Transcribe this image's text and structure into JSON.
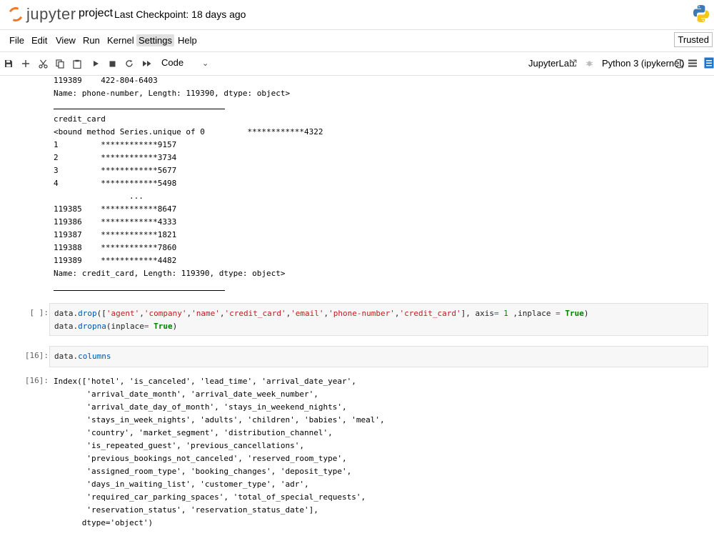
{
  "header": {
    "logo_text": "jupyter",
    "notebook_name": "project",
    "checkpoint": "Last Checkpoint: 18 days ago"
  },
  "menu": {
    "items": [
      "File",
      "Edit",
      "View",
      "Run",
      "Kernel",
      "Settings",
      "Help"
    ],
    "active": "Settings",
    "trusted": "Trusted"
  },
  "toolbar": {
    "cell_type": "Code",
    "jupyterlab_label": "JupyterLab",
    "kernel_name": "Python 3 (ipykernel)"
  },
  "output_top": {
    "lines": [
      "119389    422-804-6403",
      "Name: phone-number, Length: 119390, dtype: object>"
    ]
  },
  "output_credit": {
    "lines": [
      "credit_card",
      "<bound method Series.unique of 0         ************4322",
      "1         ************9157",
      "2         ************3734",
      "3         ************5677",
      "4         ************5498",
      "                ...",
      "119385    ************8647",
      "119386    ************4333",
      "119387    ************1821",
      "119388    ************7860",
      "119389    ************4482",
      "Name: credit_card, Length: 119390, dtype: object>"
    ]
  },
  "cell_drop": {
    "prompt": "[ ]:",
    "line1": {
      "obj": "data",
      "method": "drop",
      "args": [
        "'agent'",
        "'company'",
        "'name'",
        "'credit_card'",
        "'email'",
        "'phone-number'",
        "'credit_card'"
      ],
      "axis_kw": "axis",
      "axis_val": "1",
      "inplace_kw": "inplace",
      "inplace_val": "True"
    },
    "line2": {
      "obj": "data",
      "method": "dropna",
      "inplace_kw": "inplace",
      "inplace_val": "True"
    }
  },
  "cell_columns": {
    "prompt": "[16]:",
    "obj": "data",
    "attr": "columns"
  },
  "output_columns": {
    "prompt": "[16]:",
    "lines": [
      "Index(['hotel', 'is_canceled', 'lead_time', 'arrival_date_year',",
      "       'arrival_date_month', 'arrival_date_week_number',",
      "       'arrival_date_day_of_month', 'stays_in_weekend_nights',",
      "       'stays_in_week_nights', 'adults', 'children', 'babies', 'meal',",
      "       'country', 'market_segment', 'distribution_channel',",
      "       'is_repeated_guest', 'previous_cancellations',",
      "       'previous_bookings_not_canceled', 'reserved_room_type',",
      "       'assigned_room_type', 'booking_changes', 'deposit_type',",
      "       'days_in_waiting_list', 'customer_type', 'adr',",
      "       'required_car_parking_spaces', 'total_of_special_requests',",
      "       'reservation_status', 'reservation_status_date'],",
      "      dtype='object')"
    ]
  },
  "colors": {
    "jupyter_orange": "#f37726",
    "keyword_green": "#008000",
    "string_red": "#ba2121",
    "operator_purple": "#aa22ff",
    "kernel_status_blue": "#1976d2"
  }
}
